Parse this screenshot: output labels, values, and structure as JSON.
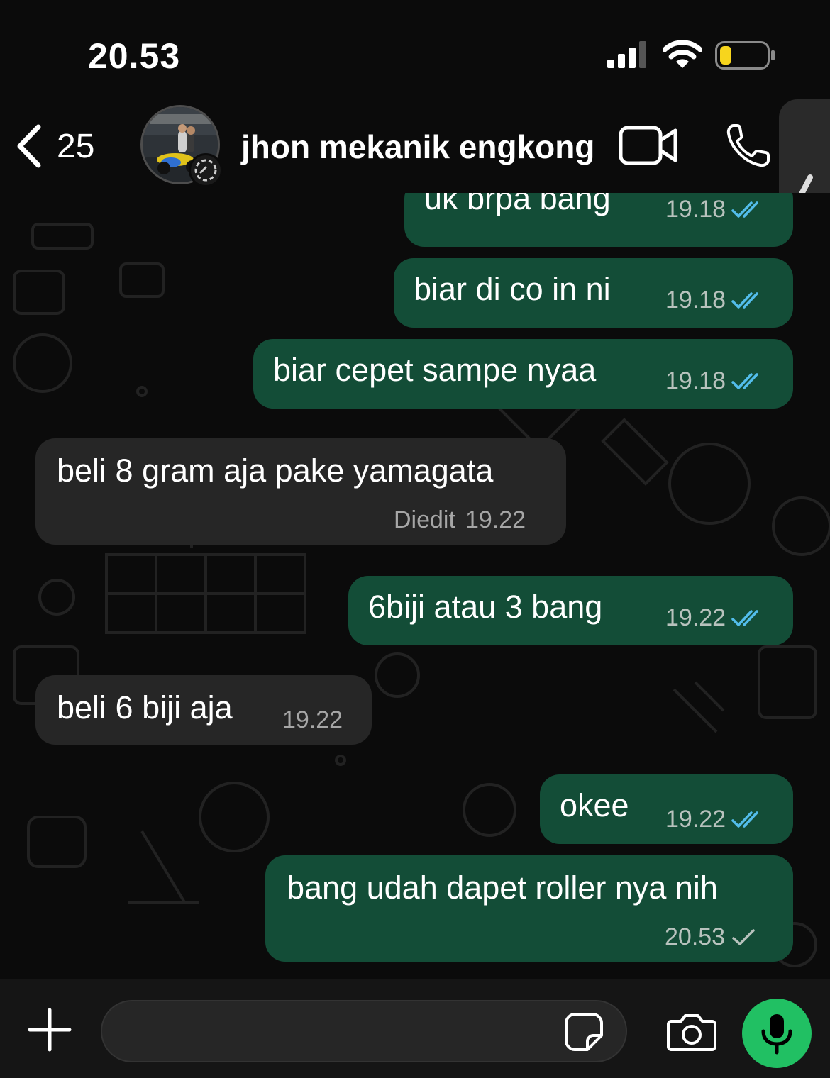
{
  "status_bar": {
    "time": "20.53",
    "icons": [
      "signal-icon",
      "wifi-icon",
      "battery-icon"
    ]
  },
  "header": {
    "back_count": "25",
    "contact_name": "jhon mekanik engkong",
    "icons": [
      "chevron-left-icon",
      "video-call-icon",
      "phone-icon"
    ]
  },
  "messages": [
    {
      "direction": "outgoing",
      "text": "uk brpa bang",
      "time": "19.18",
      "status": "read"
    },
    {
      "direction": "outgoing",
      "text": "biar di co in ni",
      "time": "19.18",
      "status": "read"
    },
    {
      "direction": "outgoing",
      "text": "biar cepet sampe nyaa",
      "time": "19.18",
      "status": "read"
    },
    {
      "direction": "incoming",
      "text": "beli 8 gram aja pake yamagata",
      "edited_label": "Diedit",
      "time": "19.22"
    },
    {
      "direction": "outgoing",
      "text": "6biji atau 3 bang",
      "time": "19.22",
      "status": "read"
    },
    {
      "direction": "incoming",
      "text": "beli 6 biji aja",
      "time": "19.22"
    },
    {
      "direction": "outgoing",
      "text": "okee",
      "time": "19.22",
      "status": "read"
    },
    {
      "direction": "outgoing",
      "text": "bang udah dapet roller nya nih",
      "time": "20.53",
      "status": "sent"
    }
  ],
  "input_bar": {
    "message_value": "",
    "icons": [
      "plus-icon",
      "sticker-icon",
      "camera-icon",
      "microphone-icon"
    ]
  },
  "colors": {
    "outgoing_bubble": "#134d37",
    "incoming_bubble": "#262626",
    "read_tick": "#53bdeb",
    "mic_button": "#21c063",
    "battery_level": "#f7d51d"
  }
}
